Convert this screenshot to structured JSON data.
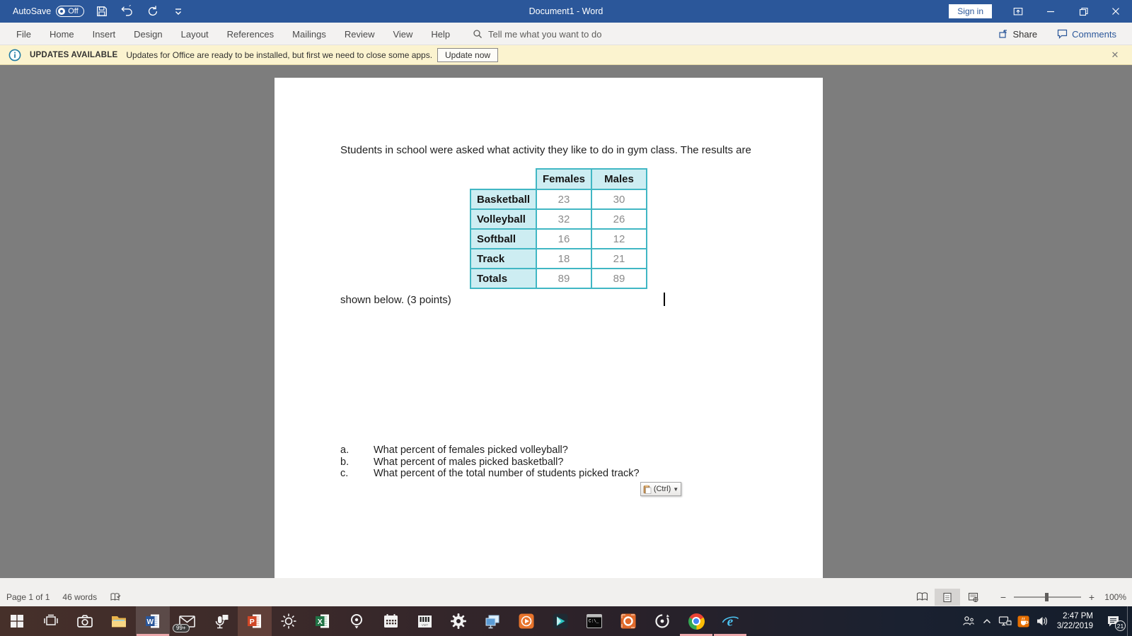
{
  "title_bar": {
    "autosave_label": "AutoSave",
    "autosave_state": "Off",
    "title": "Document1 - Word",
    "sign_in_label": "Sign in"
  },
  "ribbon": {
    "tabs": [
      "File",
      "Home",
      "Insert",
      "Design",
      "Layout",
      "References",
      "Mailings",
      "Review",
      "View",
      "Help"
    ],
    "search_text": "Tell me what you want to do",
    "share_label": "Share",
    "comments_label": "Comments"
  },
  "notification": {
    "title": "UPDATES AVAILABLE",
    "message": "Updates for Office are ready to be installed, but first we need to close some apps.",
    "button_label": "Update now",
    "close_glyph": "✕"
  },
  "document": {
    "intro_text": "Students in school were asked what activity they like to do in gym class.  The results are",
    "continuation_text": "shown below. (3 points)",
    "table": {
      "col_headers": [
        "Females",
        "Males"
      ],
      "rows": [
        {
          "label": "Basketball",
          "values": [
            "23",
            "30"
          ]
        },
        {
          "label": "Volleyball",
          "values": [
            "32",
            "26"
          ]
        },
        {
          "label": "Softball",
          "values": [
            "16",
            "12"
          ]
        },
        {
          "label": "Track",
          "values": [
            "18",
            "21"
          ]
        },
        {
          "label": "Totals",
          "values": [
            "89",
            "89"
          ]
        }
      ]
    },
    "questions": [
      {
        "letter": "a.",
        "text": "What percent of females picked volleyball?"
      },
      {
        "letter": "b.",
        "text": "What percent of males picked basketball?"
      },
      {
        "letter": "c.",
        "text": "What percent of the total number of students picked track?"
      }
    ],
    "paste_options_label": "(Ctrl)"
  },
  "status_bar": {
    "page_info": "Page 1 of 1",
    "word_count": "46 words",
    "zoom_level": "100%",
    "view_icons": [
      "read-mode",
      "print-layout-selected",
      "web-layout"
    ]
  },
  "taskbar": {
    "icons": [
      "start",
      "task-view",
      "camera",
      "file-explorer",
      "word",
      "mail",
      "microphone",
      "powerpoint",
      "weather-sun",
      "excel",
      "camera-lens",
      "calendar",
      "vmt-keyboard",
      "settings",
      "remote-desktop",
      "media-player",
      "dark-media-app",
      "command-prompt",
      "screen-recorder",
      "record-dial",
      "chrome",
      "internet-explorer"
    ],
    "mail_badge": "99+",
    "tray_icons": [
      "people",
      "hidden-icons-chevron",
      "network",
      "java-update",
      "volume",
      "clock",
      "action-center",
      "show-desktop"
    ],
    "clock_time": "2:47 PM",
    "clock_date": "3/22/2019",
    "action_center_badge": "21"
  },
  "colors": {
    "word_accent": "#2b579a",
    "notification_bg": "#fbf3cf",
    "table_border": "#41b7c4",
    "table_fill": "#cdedf2",
    "taskbar_underline": "#eba7aa"
  }
}
